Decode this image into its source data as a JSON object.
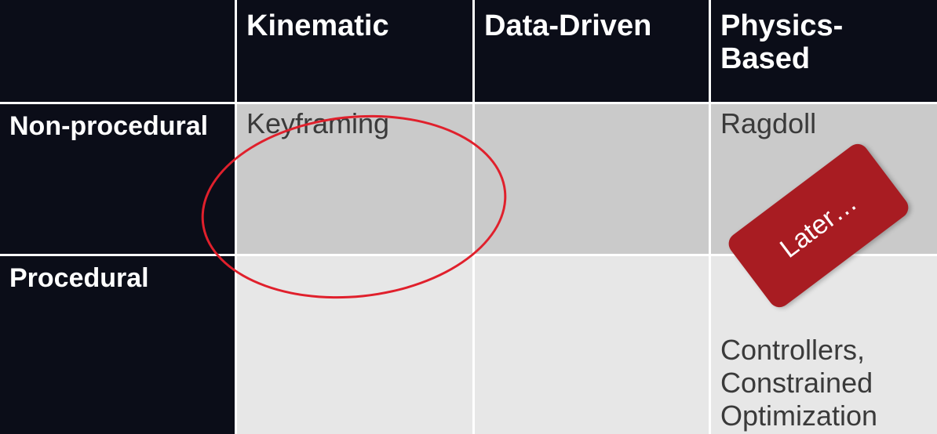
{
  "table": {
    "columns": [
      "Kinematic",
      "Data-Driven",
      "Physics-Based"
    ],
    "rows": [
      {
        "label": "Non-procedural",
        "cells": [
          "Keyframing",
          "",
          "Ragdoll"
        ]
      },
      {
        "label": "Procedural",
        "cells": [
          "",
          "",
          "Controllers, Constrained Optimization"
        ]
      }
    ]
  },
  "annotation": {
    "badge_text": "Later…",
    "badge_color": "#a81c22",
    "circle_color": "#e0202c",
    "circled_cell": "Keyframing"
  },
  "colors": {
    "header_bg": "#0b0d18",
    "row1_bg": "#cacaca",
    "row2_bg": "#e7e7e7"
  }
}
